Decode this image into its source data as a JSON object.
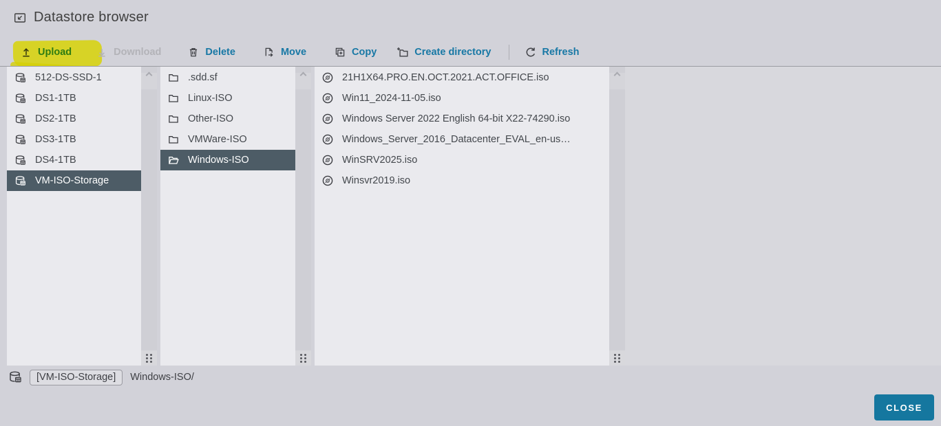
{
  "window": {
    "title": "Datastore browser"
  },
  "toolbar": {
    "upload_label": "Upload",
    "download_label": "Download",
    "delete_label": "Delete",
    "move_label": "Move",
    "copy_label": "Copy",
    "create_directory_label": "Create directory",
    "refresh_label": "Refresh"
  },
  "browser": {
    "datastores": {
      "selected": "VM-ISO-Storage",
      "items": [
        "512-DS-SSD-1",
        "DS1-1TB",
        "DS2-1TB",
        "DS3-1TB",
        "DS4-1TB",
        "VM-ISO-Storage"
      ]
    },
    "folders": {
      "selected": "Windows-ISO",
      "items": [
        ".sdd.sf",
        "Linux-ISO",
        "Other-ISO",
        "VMWare-ISO",
        "Windows-ISO"
      ]
    },
    "files": {
      "items": [
        "21H1X64.PRO.EN.OCT.2021.ACT.OFFICE.iso",
        "Win11_2024-11-05.iso",
        "Windows Server 2022 English 64-bit X22-74290.iso",
        "Windows_Server_2016_Datacenter_EVAL_en-us…",
        "WinSRV2025.iso",
        "Winsvr2019.iso"
      ]
    }
  },
  "footer": {
    "datastore_badge": "[VM-ISO-Storage]",
    "path": "Windows-ISO/",
    "close_label": "CLOSE"
  },
  "annotations": {
    "upload_highlight_color": "#d8d306"
  },
  "colors": {
    "accent_blue": "#1878a5",
    "selected_row_bg": "#4d5c66",
    "close_button_bg": "#15779f",
    "page_bg": "#d2d2d9",
    "column_bg": "#eaeaee"
  }
}
